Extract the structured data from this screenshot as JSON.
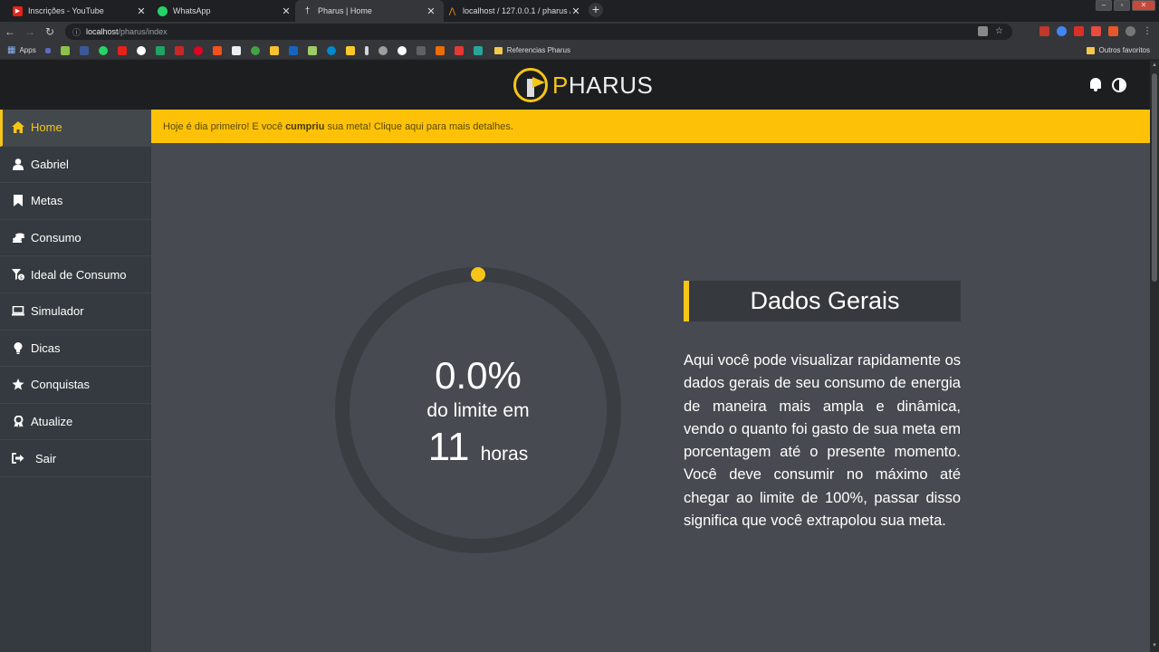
{
  "browser": {
    "tabs": [
      {
        "title": "Inscrições - YouTube",
        "favicon": "youtube-icon",
        "color": "#e62117"
      },
      {
        "title": "WhatsApp",
        "favicon": "whatsapp-icon",
        "color": "#25d366"
      },
      {
        "title": "Pharus | Home",
        "favicon": "pharus-icon",
        "color": "#cccccc"
      },
      {
        "title": "localhost / 127.0.0.1 / pharus / c…",
        "favicon": "phpmyadmin-icon",
        "color": "#f29111"
      }
    ],
    "active_tab": 2,
    "address": {
      "host": "localhost",
      "path": "/pharus/index"
    },
    "bookmarks": {
      "apps_label": "Apps",
      "folder_label": "Referencias Pharus",
      "other_label": "Outros favoritos"
    }
  },
  "header": {
    "logo_first": "P",
    "logo_rest": "HARUS"
  },
  "sidebar": {
    "items": [
      {
        "label": "Home",
        "icon": "home-icon"
      },
      {
        "label": "Gabriel",
        "icon": "user-icon"
      },
      {
        "label": "Metas",
        "icon": "bookmark-icon"
      },
      {
        "label": "Consumo",
        "icon": "coins-icon"
      },
      {
        "label": "Ideal de Consumo",
        "icon": "funnel-dollar-icon"
      },
      {
        "label": "Simulador",
        "icon": "laptop-icon"
      },
      {
        "label": "Dicas",
        "icon": "lightbulb-icon"
      },
      {
        "label": "Conquistas",
        "icon": "star-icon"
      },
      {
        "label": "Atualize",
        "icon": "award-icon"
      },
      {
        "label": "Sair",
        "icon": "sign-out-icon"
      }
    ],
    "active": "Home"
  },
  "alert": {
    "before": "Hoje é dia primeiro! E você",
    "bold": "cumpriu",
    "after": "sua meta! Clique aqui para mais detalhes."
  },
  "gauge": {
    "percent_text": "0.0%",
    "percent_value": 0.0,
    "subtitle": "do limite em",
    "hours_value": "11",
    "hours_unit": "horas",
    "track_color": "#3a3d42",
    "accent_color": "#f5c518"
  },
  "dados_gerais": {
    "title": "Dados Gerais",
    "text": "Aqui você pode visualizar rapidamente os dados gerais de seu consumo de energia de maneira mais ampla e dinâmica, vendo o quanto foi gasto de sua meta em porcentagem até o presente momento. Você deve consumir no máximo até chegar ao limite de 100%, passar disso significa que você extrapolou sua meta."
  },
  "colors": {
    "accent": "#f5c518",
    "sidebar": "#343a40",
    "content": "#474a50",
    "alert": "#fdc107"
  }
}
